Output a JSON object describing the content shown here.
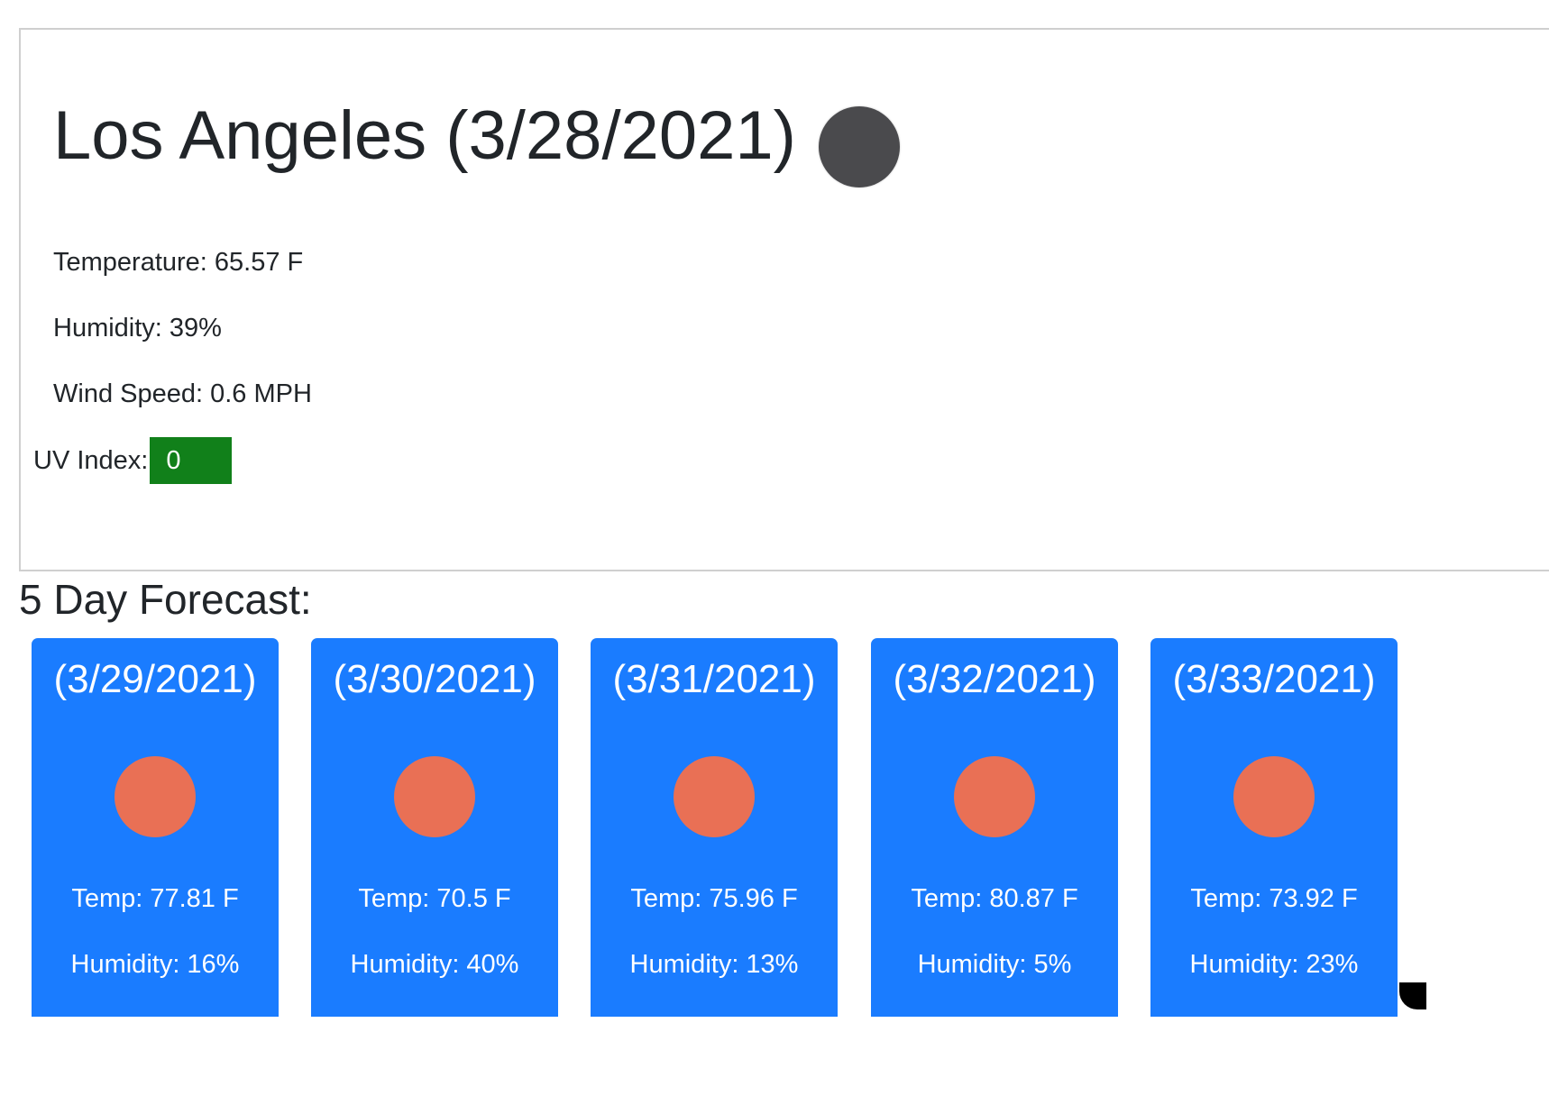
{
  "current": {
    "title": "Los Angeles (3/28/2021)",
    "icon": "weather-night-icon",
    "temperature": "Temperature: 65.57 F",
    "humidity": "Humidity: 39%",
    "wind": "Wind Speed: 0.6 MPH",
    "uv_label": "UV Index:",
    "uv_value": "0",
    "uv_color": "#11801a"
  },
  "forecast": {
    "heading": "5 Day Forecast:",
    "card_color": "#1a7cff",
    "icon_color": "#e97055",
    "days": [
      {
        "date": "(3/29/2021)",
        "icon": "weather-sun-icon",
        "temp": "Temp: 77.81 F",
        "humidity": "Humidity: 16%"
      },
      {
        "date": "(3/30/2021)",
        "icon": "weather-sun-icon",
        "temp": "Temp: 70.5 F",
        "humidity": "Humidity: 40%"
      },
      {
        "date": "(3/31/2021)",
        "icon": "weather-sun-icon",
        "temp": "Temp: 75.96 F",
        "humidity": "Humidity: 13%"
      },
      {
        "date": "(3/32/2021)",
        "icon": "weather-sun-icon",
        "temp": "Temp: 80.87 F",
        "humidity": "Humidity: 5%"
      },
      {
        "date": "(3/33/2021)",
        "icon": "weather-sun-icon",
        "temp": "Temp: 73.92 F",
        "humidity": "Humidity: 23%"
      }
    ]
  }
}
